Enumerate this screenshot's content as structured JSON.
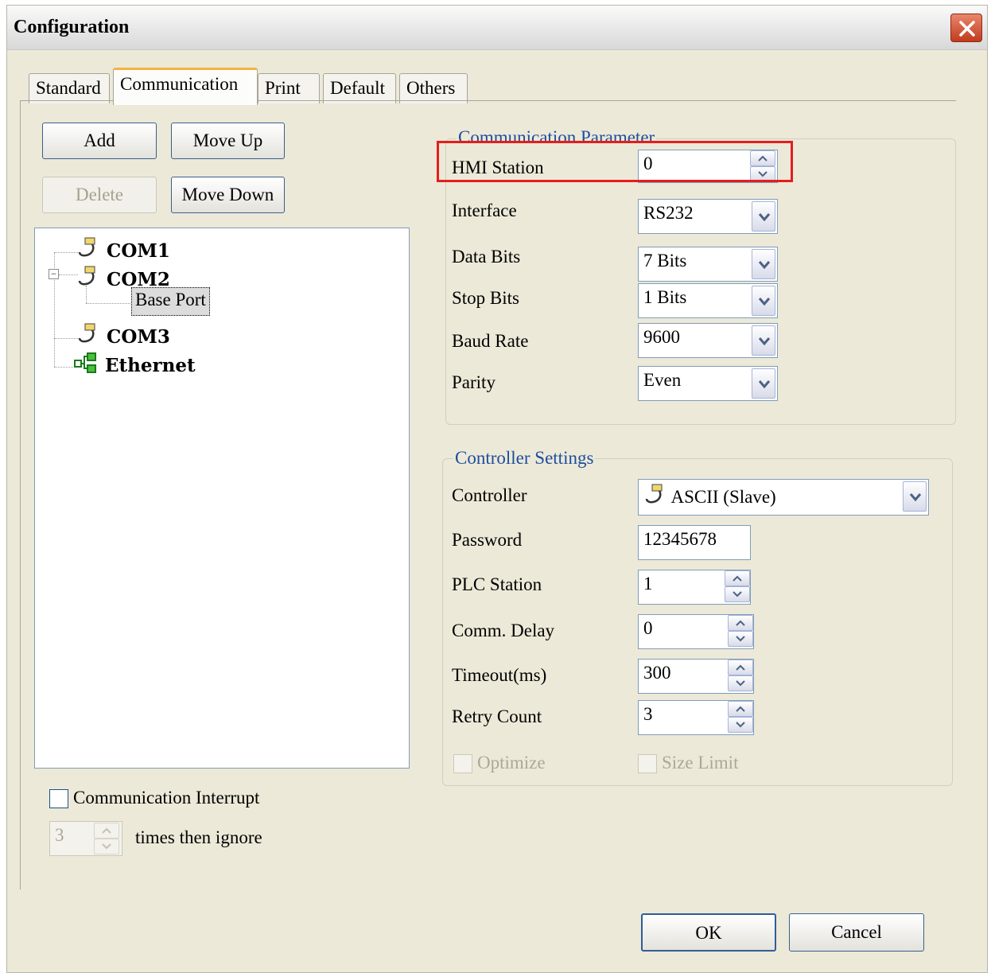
{
  "window": {
    "title": "Configuration"
  },
  "tabs": [
    "Standard",
    "Communication",
    "Print",
    "Default",
    "Others"
  ],
  "buttons": {
    "add": "Add",
    "move_up": "Move Up",
    "delete": "Delete",
    "move_down": "Move Down",
    "ok": "OK",
    "cancel": "Cancel"
  },
  "tree": {
    "com1": "COM1",
    "com2": "COM2",
    "base_port": "Base Port",
    "com3": "COM3",
    "ethernet": "Ethernet"
  },
  "interrupt": {
    "label": "Communication Interrupt",
    "checked": false,
    "times_value": "3",
    "suffix": "times  then ignore"
  },
  "comm_param": {
    "title": "Communication Parameter",
    "hmi_station_label": "HMI Station",
    "hmi_station_value": "0",
    "interface_label": "Interface",
    "interface_value": "RS232",
    "data_bits_label": "Data Bits",
    "data_bits_value": "7 Bits",
    "stop_bits_label": "Stop Bits",
    "stop_bits_value": "1 Bits",
    "baud_rate_label": "Baud Rate",
    "baud_rate_value": "9600",
    "parity_label": "Parity",
    "parity_value": "Even"
  },
  "controller": {
    "title": "Controller Settings",
    "controller_label": "Controller",
    "controller_value": "ASCII (Slave)",
    "password_label": "Password",
    "password_value": "12345678",
    "plc_station_label": "PLC Station",
    "plc_station_value": "1",
    "comm_delay_label": "Comm. Delay",
    "comm_delay_value": "0",
    "timeout_label": "Timeout(ms)",
    "timeout_value": "300",
    "retry_label": "Retry Count",
    "retry_value": "3",
    "optimize_label": "Optimize",
    "size_limit_label": "Size Limit"
  },
  "colors": {
    "highlight": "#e51d1d",
    "group_title": "#1d4d9e",
    "tab_accent": "#f5b342"
  }
}
